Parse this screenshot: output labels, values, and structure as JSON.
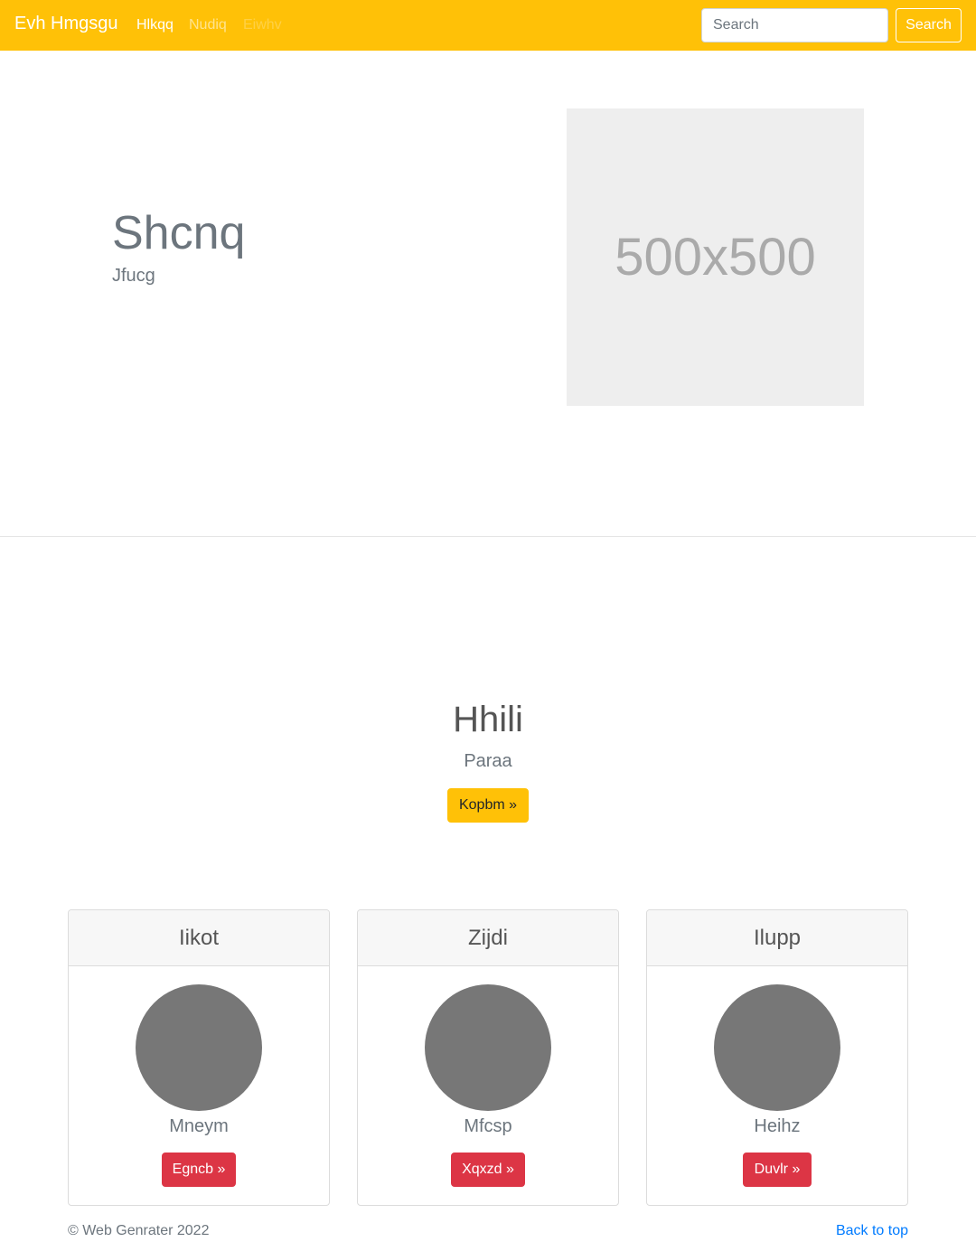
{
  "navbar": {
    "brand": "Evh Hmgsgu",
    "links": [
      "Hlkqq",
      "Nudiq",
      "Eiwhv"
    ],
    "search": {
      "placeholder": "Search",
      "button_label": "Search"
    },
    "colors": {
      "background": "#ffc107"
    }
  },
  "hero": {
    "title": "Shcnq",
    "subtitle": "Jfucg",
    "image_label": "500x500"
  },
  "feature": {
    "title": "Hhili",
    "subtitle": "Paraa",
    "button_label": "Kopbm »"
  },
  "cards": [
    {
      "header": "Iikot",
      "name": "Mneym",
      "button_label": "Egncb »"
    },
    {
      "header": "Zijdi",
      "name": "Mfcsp",
      "button_label": "Xqxzd »"
    },
    {
      "header": "Ilupp",
      "name": "Heihz",
      "button_label": "Duvlr »"
    }
  ],
  "footer": {
    "copyright": "© Web Genrater 2022",
    "back_to_top": "Back to top"
  }
}
